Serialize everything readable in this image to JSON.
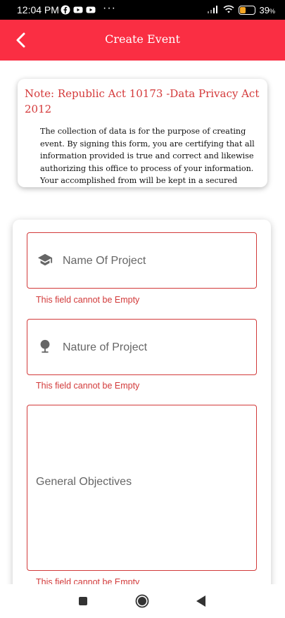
{
  "status_bar": {
    "time": "12:04 PM",
    "more": "···",
    "battery": "39",
    "battery_unit": "%"
  },
  "header": {
    "title": "Create Event"
  },
  "note": {
    "title": "Note: Republic Act 10173 -Data Privacy Act 2012",
    "body": "The collection of data is for the purpose of creating event. By signing this form, you are certifying that all information provided is true and correct and likewise authorizing this office to process of your information. Your accomplished from will be kept in a secured"
  },
  "form": {
    "project_name": {
      "placeholder": "Name Of Project",
      "value": "",
      "error": "This field cannot be Empty"
    },
    "nature": {
      "placeholder": "Nature of Project",
      "value": "",
      "error": "This field cannot be Empty"
    },
    "objectives": {
      "placeholder": "General Objectives",
      "value": "",
      "error": "This field cannot be Empty"
    }
  },
  "icons": {
    "back": "back-arrow-icon",
    "project": "graduation-cap-icon",
    "nature": "tree-icon"
  },
  "colors": {
    "accent": "#fa2e43",
    "error": "#d23a3a",
    "note_title": "#d4393a"
  }
}
